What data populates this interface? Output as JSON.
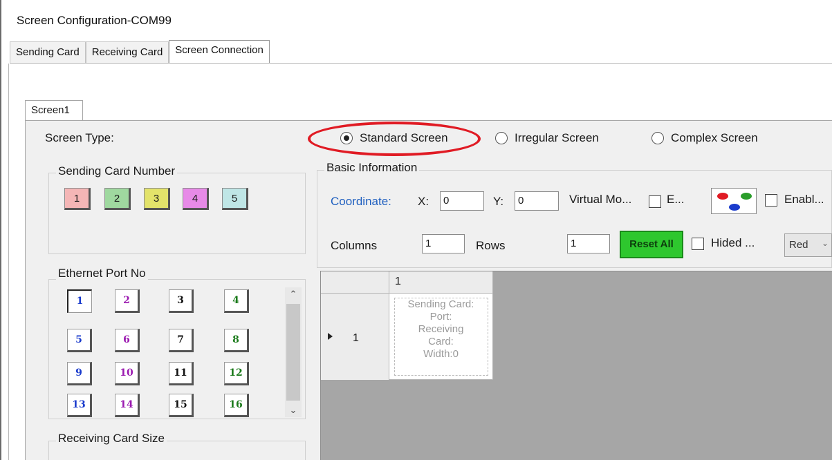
{
  "window": {
    "title": "Screen Configuration-COM99"
  },
  "tabs": [
    {
      "label": "Sending Card"
    },
    {
      "label": "Receiving Card"
    },
    {
      "label": "Screen Connection"
    }
  ],
  "subtab": {
    "label": "Screen1"
  },
  "screen_type": {
    "label": "Screen Type:",
    "options": [
      {
        "label": "Standard Screen",
        "selected": true
      },
      {
        "label": "Irregular Screen",
        "selected": false
      },
      {
        "label": "Complex Screen",
        "selected": false
      }
    ],
    "highlight_color": "#e01b24"
  },
  "sending_card": {
    "title": "Sending Card Number",
    "buttons": [
      {
        "label": "1",
        "color": "#f4b6b6",
        "selected": true
      },
      {
        "label": "2",
        "color": "#9fd89f"
      },
      {
        "label": "3",
        "color": "#e3e36a"
      },
      {
        "label": "4",
        "color": "#e78ae7"
      },
      {
        "label": "5",
        "color": "#bfe6e6"
      }
    ]
  },
  "ethernet": {
    "title": "Ethernet Port No",
    "ports": [
      {
        "label": "1",
        "color": "#1a3bcc",
        "selected": true
      },
      {
        "label": "2",
        "color": "#9b1ab0"
      },
      {
        "label": "3",
        "color": "#111111"
      },
      {
        "label": "4",
        "color": "#1a7a1a"
      },
      {
        "label": "5",
        "color": "#1a3bcc"
      },
      {
        "label": "6",
        "color": "#9b1ab0"
      },
      {
        "label": "7",
        "color": "#111111"
      },
      {
        "label": "8",
        "color": "#1a7a1a"
      },
      {
        "label": "9",
        "color": "#1a3bcc"
      },
      {
        "label": "10",
        "color": "#9b1ab0"
      },
      {
        "label": "11",
        "color": "#111111"
      },
      {
        "label": "12",
        "color": "#1a7a1a"
      },
      {
        "label": "13",
        "color": "#1a3bcc"
      },
      {
        "label": "14",
        "color": "#9b1ab0"
      },
      {
        "label": "15",
        "color": "#111111"
      },
      {
        "label": "16",
        "color": "#1a7a1a"
      }
    ]
  },
  "receiving_size": {
    "title": "Receiving Card Size"
  },
  "basic_info": {
    "title": "Basic Information",
    "coordinate_label": "Coordinate:",
    "x_label": "X:",
    "x_value": "0",
    "y_label": "Y:",
    "y_value": "0",
    "virtual_label": "Virtual Mo...",
    "e_label": "E...",
    "enable_label": "Enabl...",
    "columns_label": "Columns",
    "columns_value": "1",
    "rows_label": "Rows",
    "rows_value": "1",
    "reset_label": "Reset All",
    "hided_label": "Hided ...",
    "color_select_value": "Red",
    "swatch_colors": [
      "#e01b24",
      "#2a9d2a",
      "#1a3bcc"
    ]
  },
  "grid": {
    "col_header": "1",
    "row_header": "1",
    "cell_lines": [
      "Sending Card:",
      "Port:",
      "Receiving",
      "Card:",
      "Width:0"
    ]
  }
}
